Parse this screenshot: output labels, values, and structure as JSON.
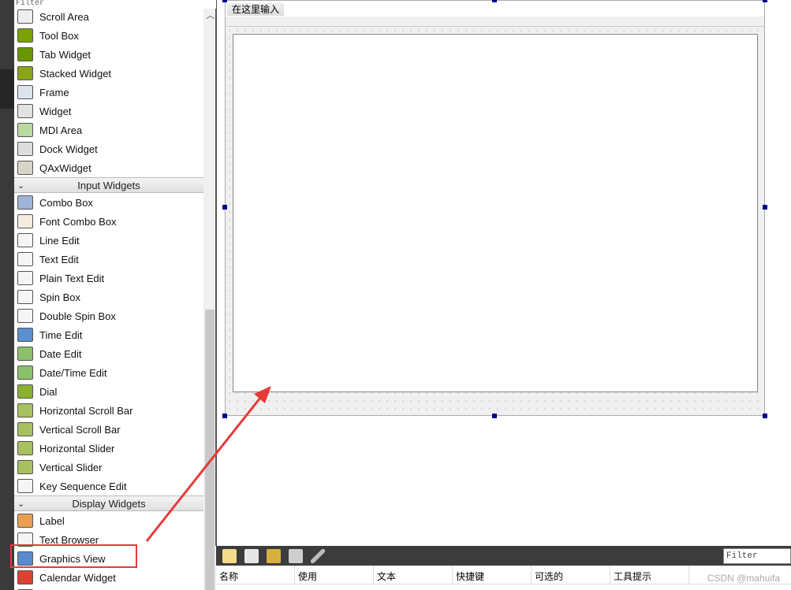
{
  "filter_label": "Filter",
  "widget_box": [
    {
      "type": "item",
      "label": "Scroll Area",
      "icon": "scroll-area-icon",
      "color": "#eeeeee"
    },
    {
      "type": "item",
      "label": "Tool Box",
      "icon": "tool-box-icon",
      "color": "#7ba200"
    },
    {
      "type": "item",
      "label": "Tab Widget",
      "icon": "tab-widget-icon",
      "color": "#6a9600"
    },
    {
      "type": "item",
      "label": "Stacked Widget",
      "icon": "stacked-widget-icon",
      "color": "#8aa51a"
    },
    {
      "type": "item",
      "label": "Frame",
      "icon": "frame-icon",
      "color": "#dde4ee"
    },
    {
      "type": "item",
      "label": "Widget",
      "icon": "widget-icon",
      "color": "#e2e2e2"
    },
    {
      "type": "item",
      "label": "MDI Area",
      "icon": "mdi-area-icon",
      "color": "#b9d9a0"
    },
    {
      "type": "item",
      "label": "Dock Widget",
      "icon": "dock-widget-icon",
      "color": "#dddddd"
    },
    {
      "type": "item",
      "label": "QAxWidget",
      "icon": "qaxwidget-icon",
      "color": "#d8d4c8"
    },
    {
      "type": "category",
      "label": "Input Widgets"
    },
    {
      "type": "item",
      "label": "Combo Box",
      "icon": "combo-box-icon",
      "color": "#9db4d6"
    },
    {
      "type": "item",
      "label": "Font Combo Box",
      "icon": "font-combo-box-icon",
      "color": "#f4ece0"
    },
    {
      "type": "item",
      "label": "Line Edit",
      "icon": "line-edit-icon",
      "color": "#f5f5f5"
    },
    {
      "type": "item",
      "label": "Text Edit",
      "icon": "text-edit-icon",
      "color": "#f5f5f5"
    },
    {
      "type": "item",
      "label": "Plain Text Edit",
      "icon": "plain-text-edit-icon",
      "color": "#f5f5f5"
    },
    {
      "type": "item",
      "label": "Spin Box",
      "icon": "spin-box-icon",
      "color": "#f5f5f5"
    },
    {
      "type": "item",
      "label": "Double Spin Box",
      "icon": "double-spin-box-icon",
      "color": "#f5f5f5"
    },
    {
      "type": "item",
      "label": "Time Edit",
      "icon": "clock-icon",
      "color": "#5b8fd0"
    },
    {
      "type": "item",
      "label": "Date Edit",
      "icon": "calendar-icon",
      "color": "#8cc06a"
    },
    {
      "type": "item",
      "label": "Date/Time Edit",
      "icon": "calendar-clock-icon",
      "color": "#8cc06a"
    },
    {
      "type": "item",
      "label": "Dial",
      "icon": "dial-icon",
      "color": "#8ab030"
    },
    {
      "type": "item",
      "label": "Horizontal Scroll Bar",
      "icon": "horizontal-scroll-bar-icon",
      "color": "#a8c060"
    },
    {
      "type": "item",
      "label": "Vertical Scroll Bar",
      "icon": "vertical-scroll-bar-icon",
      "color": "#a8c060"
    },
    {
      "type": "item",
      "label": "Horizontal Slider",
      "icon": "horizontal-slider-icon",
      "color": "#a8c060"
    },
    {
      "type": "item",
      "label": "Vertical Slider",
      "icon": "vertical-slider-icon",
      "color": "#a8c060"
    },
    {
      "type": "item",
      "label": "Key Sequence Edit",
      "icon": "key-sequence-edit-icon",
      "color": "#f5f5f5"
    },
    {
      "type": "category",
      "label": "Display Widgets"
    },
    {
      "type": "item",
      "label": "Label",
      "icon": "label-tag-icon",
      "color": "#e8a050"
    },
    {
      "type": "item",
      "label": "Text Browser",
      "icon": "text-browser-icon",
      "color": "#f5f5f5"
    },
    {
      "type": "item",
      "label": "Graphics View",
      "icon": "graphics-view-icon",
      "color": "#5a8ad0"
    },
    {
      "type": "item",
      "label": "Calendar Widget",
      "icon": "calendar-widget-icon",
      "color": "#e04030"
    },
    {
      "type": "item",
      "label": "",
      "icon": "lcd-number-icon",
      "color": "#4a6a9a"
    }
  ],
  "form": {
    "menu_placeholder": "在这里输入"
  },
  "action_editor": {
    "toolbar_icons": [
      "new-action-icon",
      "copy-action-icon",
      "paste-action-icon",
      "delete-action-icon",
      "settings-wrench-icon"
    ],
    "filter_placeholder": "Filter",
    "columns": [
      "名称",
      "使用",
      "文本",
      "快捷键",
      "可选的",
      "工具提示"
    ]
  },
  "watermark": "CSDN @mahuifa",
  "annotation_color": "#e63a3a"
}
